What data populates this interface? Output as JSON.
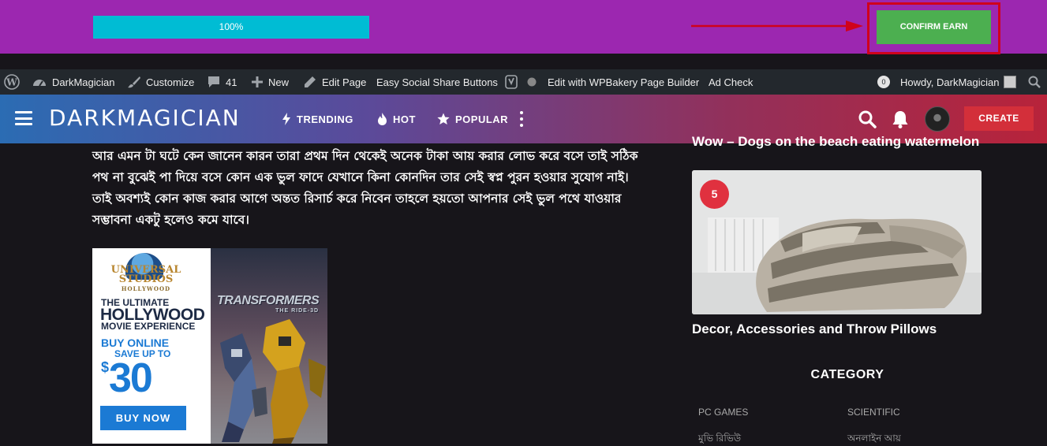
{
  "earn_bar": {
    "progress_text": "100%",
    "progress_value": 100,
    "confirm_label": "CONFIRM EARN",
    "colors": {
      "background": "#9c27b0",
      "progress": "#00bcd4",
      "confirm": "#4caf50",
      "highlight": "#d0021b"
    }
  },
  "admin_bar": {
    "items": [
      {
        "icon": "wordpress-icon",
        "label": ""
      },
      {
        "icon": "dashboard-icon",
        "label": "DarkMagician"
      },
      {
        "icon": "brush-icon",
        "label": "Customize"
      },
      {
        "icon": "comment-icon",
        "label": "41"
      },
      {
        "icon": "plus-icon",
        "label": "New"
      },
      {
        "icon": "pencil-icon",
        "label": "Edit Page"
      },
      {
        "icon": "",
        "label": "Easy Social Share Buttons"
      },
      {
        "icon": "yoast-icon",
        "label": ""
      },
      {
        "icon": "status-dot-icon",
        "label": ""
      },
      {
        "icon": "",
        "label": "Edit with WPBakery Page Builder"
      },
      {
        "icon": "",
        "label": "Ad Check"
      }
    ],
    "notification_count": "0",
    "greeting": "Howdy, DarkMagician"
  },
  "site_header": {
    "brand": "DARKMAGICIAN",
    "nav": [
      {
        "icon": "bolt-icon",
        "label": "TRENDING"
      },
      {
        "icon": "flame-icon",
        "label": "HOT"
      },
      {
        "icon": "star-icon",
        "label": "POPULAR"
      }
    ],
    "create_label": "CREATE"
  },
  "article": {
    "text": "আর এমন টা ঘটে কেন জানেন কারন তারা প্রথম দিন থেকেই অনেক টাকা আয় করার লোভ করে বসে তাই সঠিক পথ না বুঝেই পা দিয়ে বসে কোন এক ভুল ফাদে যেখানে কিনা কোনদিন তার সেই স্বপ্ন পুরন হওয়ার সুযোগ নাই। তাই অবশ্যই কোন কাজ করার আগে অন্তত রিসার্চ করে নিবেন তাহলে হয়তো আপনার সেই ভুল পথে যাওয়ার সম্ভাবনা একটু হলেও কমে যাবে।"
  },
  "ad": {
    "logo_main": "UNIVERSAL STUDIOS",
    "logo_sub": "HOLLYWOOD",
    "line1": "THE ULTIMATE",
    "line2": "HOLLYWOOD",
    "line3": "MOVIE EXPERIENCE",
    "line4": "BUY ONLINE",
    "line5": "SAVE UP TO",
    "currency": "$",
    "amount": "30",
    "button": "BUY NOW",
    "brand_art": "TRANSFORMERS",
    "brand_art_sub": "THE RIDE-3D"
  },
  "sidebar": {
    "prev_title": "Wow – Dogs on the beach eating watermelon",
    "card": {
      "rank": "5",
      "title": "Decor, Accessories and Throw Pillows"
    },
    "category_title": "CATEGORY",
    "categories": [
      "PC GAMES",
      "SCIENTIFIC",
      "মুভি রিভিউ",
      "অনলাইন আয়"
    ]
  }
}
